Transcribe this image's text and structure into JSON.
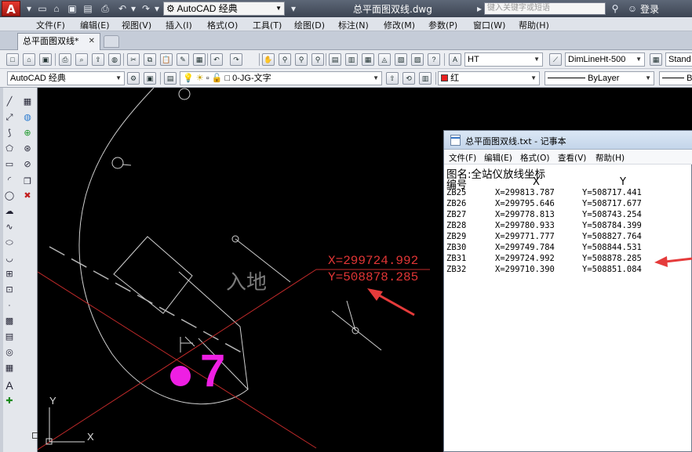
{
  "app": {
    "logo": "A",
    "workspace": "AutoCAD 经典",
    "document_title": "总平面图双线.dwg",
    "search_placeholder": "键入关键字或短语",
    "login": "登录"
  },
  "menu": [
    "文件(F)",
    "编辑(E)",
    "视图(V)",
    "插入(I)",
    "格式(O)",
    "工具(T)",
    "绘图(D)",
    "标注(N)",
    "修改(M)",
    "参数(P)",
    "窗口(W)",
    "帮助(H)"
  ],
  "file_tab": {
    "label": "总平面图双线*",
    "close": "✕"
  },
  "toolbar1": {
    "text_style": "HT",
    "dim_style": "DimLineHt-500",
    "table_style": "Stand"
  },
  "toolbar2": {
    "workspace": "AutoCAD 经典",
    "layer": "0-JG-文字",
    "color": "红",
    "linetype": "ByLayer",
    "lineweight": "B"
  },
  "colors": {
    "coord_red": "#e03535",
    "magenta": "#ee1fe3",
    "accent_red": "#e53b3b"
  },
  "drawing": {
    "coord_x": "X=299724.992",
    "coord_y": "Y=508878.285",
    "label_land": "入地",
    "label_number": "7",
    "ucs_y": "Y",
    "ucs_x": "X"
  },
  "notepad": {
    "title": "总平面图双线.txt - 记事本",
    "menu": [
      "文件(F)",
      "编辑(E)",
      "格式(O)",
      "查看(V)",
      "帮助(H)"
    ],
    "heading": "图名:全站仪放线坐标",
    "col_id": "编号",
    "col_x": "X",
    "col_y": "Y",
    "rows": [
      {
        "id": "ZB25",
        "x": "X=299813.787",
        "y": "Y=508717.441"
      },
      {
        "id": "ZB26",
        "x": "X=299795.646",
        "y": "Y=508717.677"
      },
      {
        "id": "ZB27",
        "x": "X=299778.813",
        "y": "Y=508743.254"
      },
      {
        "id": "ZB28",
        "x": "X=299780.933",
        "y": "Y=508784.399"
      },
      {
        "id": "ZB29",
        "x": "X=299771.777",
        "y": "Y=508827.764"
      },
      {
        "id": "ZB30",
        "x": "X=299749.784",
        "y": "Y=508844.531"
      },
      {
        "id": "ZB31",
        "x": "X=299724.992",
        "y": "Y=508878.285"
      },
      {
        "id": "ZB32",
        "x": "X=299710.390",
        "y": "Y=508851.084"
      }
    ]
  }
}
